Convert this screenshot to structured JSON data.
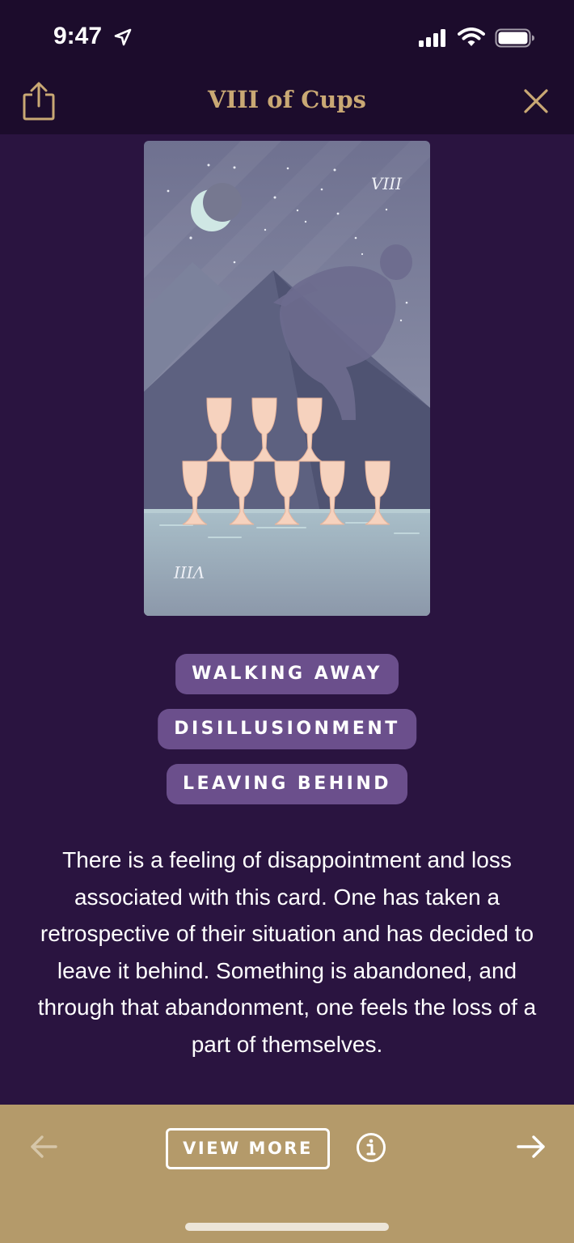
{
  "status_bar": {
    "time": "9:47"
  },
  "nav": {
    "title": "VIII of Cups",
    "share_icon": "share-icon",
    "close_icon": "close-icon"
  },
  "card": {
    "top_numeral": "VIII",
    "bottom_numeral": "VIII"
  },
  "keywords": [
    "WALKING AWAY",
    "DISILLUSIONMENT",
    "LEAVING BEHIND"
  ],
  "description": "There is a feeling of disappointment and loss associated with this card. One has taken a retrospective of their situation and has decided to leave it behind. Something is abandoned, and through that abandonment, one feels the loss of a part of themselves.",
  "bottom_bar": {
    "view_more_label": "VIEW MORE",
    "prev_icon": "arrow-left-icon",
    "next_icon": "arrow-right-icon",
    "info_icon": "info-icon"
  },
  "colors": {
    "background": "#2a1440",
    "header": "#1c0c2c",
    "title_gold": "#c9a874",
    "pill": "#6b4f8c",
    "bottom_bar": "#b49a6a"
  }
}
